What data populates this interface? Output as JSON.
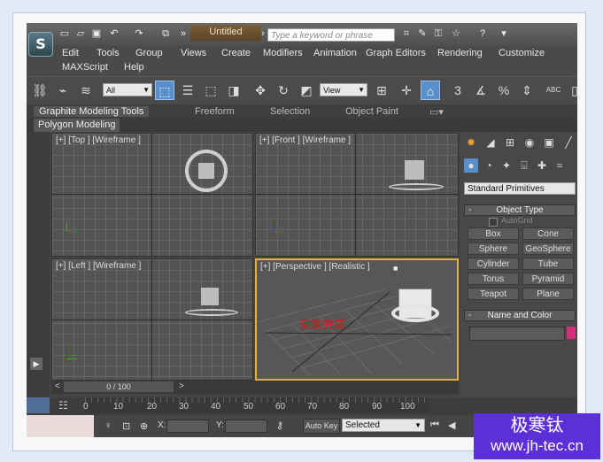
{
  "app": {
    "doc_title": "Untitled",
    "search_placeholder": "Type a keyword or phrase",
    "logo": "S"
  },
  "menu": [
    "Edit",
    "Tools",
    "Group",
    "Views",
    "Create",
    "Modifiers",
    "Animation",
    "Graph Editors",
    "Rendering",
    "Customize",
    "MAXScript",
    "Help"
  ],
  "toolbar": {
    "filter_value": "All",
    "view_value": "View",
    "snap_3": "3",
    "snap_pct": "%",
    "abc": "ABC"
  },
  "ribbon": {
    "tabs": [
      "Graphite Modeling Tools",
      "Freeform",
      "Selection",
      "Object Paint"
    ],
    "subtab": "Polygon Modeling"
  },
  "viewports": {
    "top": "[+] [Top ] [Wireframe ]",
    "front": "[+] [Front ] [Wireframe ]",
    "left": "[+] [Left ] [Wireframe ]",
    "persp": "[+] [Perspective ] [Realistic ]",
    "persp_overlay": "安装完成"
  },
  "command_panel": {
    "dropdown": "Standard Primitives",
    "object_type": "Object Type",
    "autogrid": "AutoGrid",
    "buttons": [
      "Box",
      "Cone",
      "Sphere",
      "GeoSphere",
      "Cylinder",
      "Tube",
      "Torus",
      "Pyramid",
      "Teapot",
      "Plane"
    ],
    "name_color": "Name and Color",
    "rollout_sign": "-"
  },
  "timeline": {
    "counter": "0 / 100",
    "ticks": [
      "0",
      "10",
      "20",
      "30",
      "40",
      "50",
      "60",
      "70",
      "80",
      "90",
      "100"
    ]
  },
  "status": {
    "x_label": "X:",
    "y_label": "Y:",
    "autokey": "Auto Key",
    "selected": "Selected"
  },
  "watermark": {
    "line1": "极寒钛",
    "line2": "www.jh-tec.cn"
  },
  "colors": {
    "accent_blue": "#5a8ec8",
    "active_viewport": "#e0b040",
    "watermark_bg": "#5d2fd6",
    "swatch": "#d2307a"
  }
}
